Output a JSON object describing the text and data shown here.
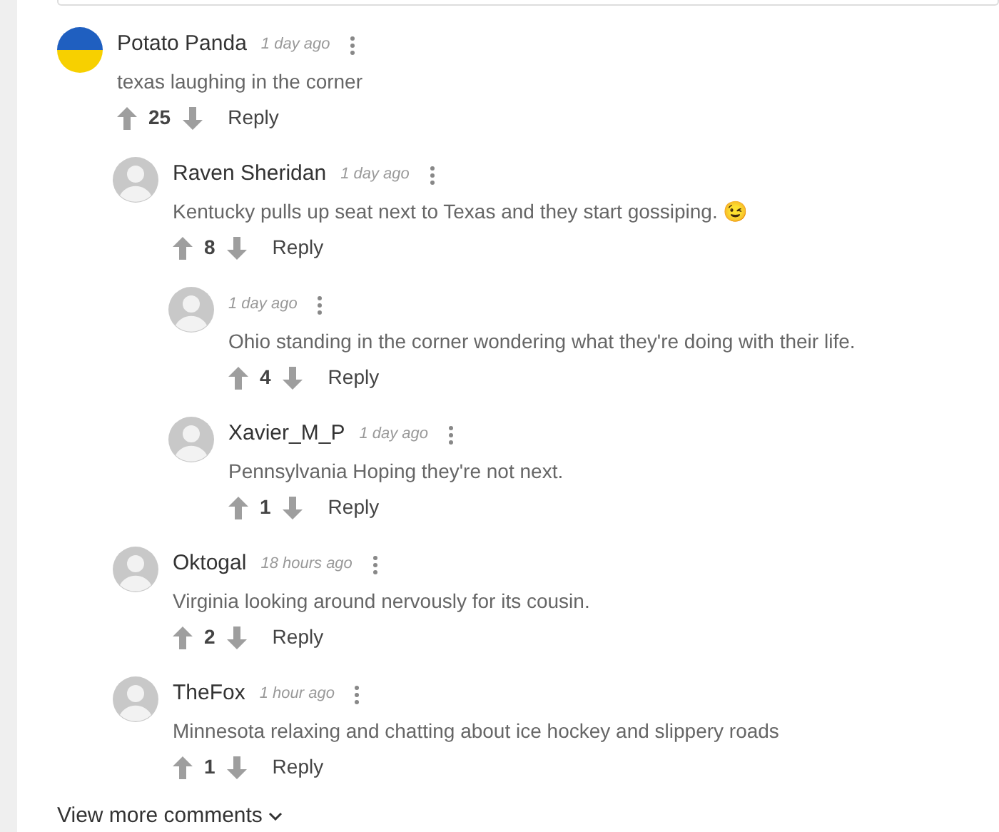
{
  "comments": [
    {
      "kind": "flag",
      "author": "Potato Panda",
      "time": "1 day ago",
      "text": "texas laughing in the corner",
      "votes": "25",
      "reply": "Reply",
      "children": [
        {
          "kind": "photo",
          "author": "Raven Sheridan",
          "time": "1 day ago",
          "text": "Kentucky pulls up seat next to Texas and they start gossiping. 😉",
          "votes": "8",
          "reply": "Reply",
          "children": [
            {
              "kind": "photo",
              "time": "1 day ago",
              "text": "Ohio standing in the corner wondering what they're doing with their life.",
              "votes": "4",
              "reply": "Reply"
            },
            {
              "kind": "photo",
              "author": "Xavier_M_P",
              "time": "1 day ago",
              "text": "Pennsylvania Hoping they're not next.",
              "votes": "1",
              "reply": "Reply"
            }
          ]
        },
        {
          "kind": "photo",
          "author": "Oktogal",
          "time": "18 hours ago",
          "text": "Virginia looking around nervously for its cousin.",
          "votes": "2",
          "reply": "Reply"
        },
        {
          "kind": "photo",
          "author": "TheFox",
          "time": "1 hour ago",
          "text": "Minnesota relaxing and chatting about ice hockey and slippery roads",
          "votes": "1",
          "reply": "Reply"
        }
      ]
    }
  ],
  "view_more": "View more comments"
}
